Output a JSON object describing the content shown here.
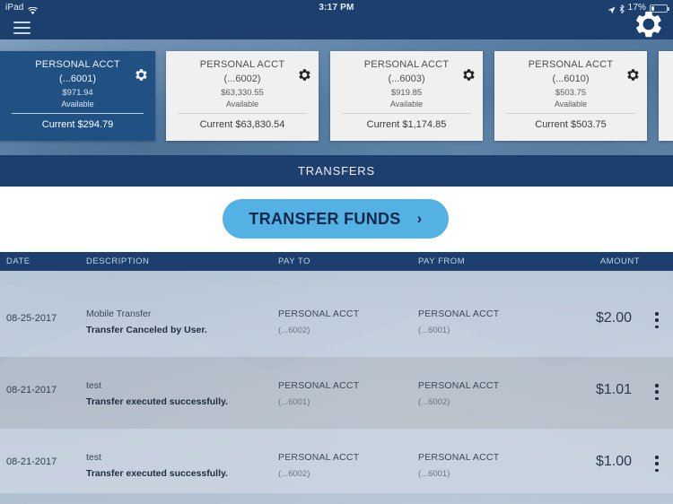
{
  "statusbar": {
    "device_label": "iPad",
    "wifi_icon": "wifi-icon",
    "time": "3:17 PM",
    "location_icon": "location-arrow-icon",
    "bluetooth_icon": "bluetooth-icon",
    "battery_percent": "17%",
    "battery_icon": "battery-icon"
  },
  "navbar": {
    "menu_icon": "hamburger-menu-icon",
    "settings_icon": "gear-icon"
  },
  "accounts": [
    {
      "name": "PERSONAL ACCT",
      "number": "(...6001)",
      "available_amount": "$971.94",
      "available_label": "Available",
      "current": "Current $294.79",
      "gear_icon": "gear-icon",
      "selected": true
    },
    {
      "name": "PERSONAL ACCT",
      "number": "(...6002)",
      "available_amount": "$63,330.55",
      "available_label": "Available",
      "current": "Current $63,830.54",
      "gear_icon": "gear-icon",
      "selected": false
    },
    {
      "name": "PERSONAL ACCT",
      "number": "(...6003)",
      "available_amount": "$919.85",
      "available_label": "Available",
      "current": "Current $1,174.85",
      "gear_icon": "gear-icon",
      "selected": false
    },
    {
      "name": "PERSONAL ACCT",
      "number": "(...6010)",
      "available_amount": "$503.75",
      "available_label": "Available",
      "current": "Current $503.75",
      "gear_icon": "gear-icon",
      "selected": false
    }
  ],
  "section": {
    "title": "TRANSFERS"
  },
  "action": {
    "transfer_button_label": "TRANSFER FUNDS",
    "chevron_icon": "chevron-right-icon"
  },
  "table": {
    "columns": {
      "date": "DATE",
      "description": "DESCRIPTION",
      "pay_to": "PAY TO",
      "pay_from": "PAY FROM",
      "amount": "AMOUNT"
    },
    "rows": [
      {
        "date": "08-25-2017",
        "desc_title": "Mobile Transfer",
        "desc_status": "Transfer Canceled by User.",
        "pay_to_name": "PERSONAL ACCT",
        "pay_to_num": "(...6002)",
        "pay_from_name": "PERSONAL ACCT",
        "pay_from_num": "(...6001)",
        "amount": "$2.00",
        "menu_icon": "kebab-menu-icon"
      },
      {
        "date": "08-21-2017",
        "desc_title": "test",
        "desc_status": "Transfer executed successfully.",
        "pay_to_name": "PERSONAL ACCT",
        "pay_to_num": "(...6001)",
        "pay_from_name": "PERSONAL ACCT",
        "pay_from_num": "(...6002)",
        "amount": "$1.01",
        "menu_icon": "kebab-menu-icon"
      },
      {
        "date": "08-21-2017",
        "desc_title": "test",
        "desc_status": "Transfer executed successfully.",
        "pay_to_name": "PERSONAL ACCT",
        "pay_to_num": "(...6002)",
        "pay_from_name": "PERSONAL ACCT",
        "pay_from_num": "(...6001)",
        "amount": "$1.00",
        "menu_icon": "kebab-menu-icon"
      }
    ]
  },
  "colors": {
    "navy": "#1c3f6e",
    "card_active": "#215183",
    "button_blue": "#53b2e3",
    "button_text": "#14294a",
    "row_light": "#cdd6e2",
    "row_dark": "#bcc2cb"
  }
}
